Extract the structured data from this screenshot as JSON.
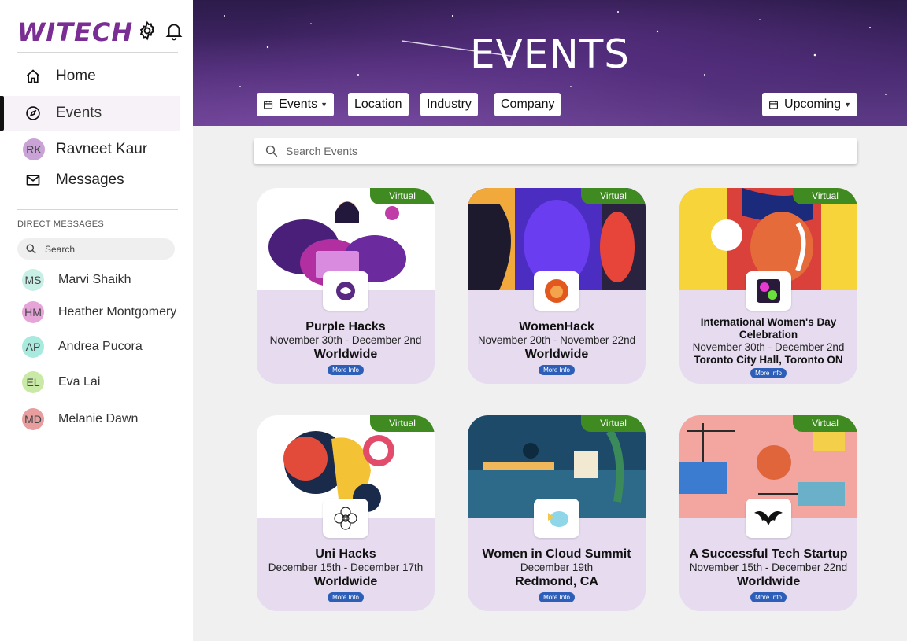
{
  "app": {
    "logo": "WITECH"
  },
  "nav": [
    {
      "label": "Home",
      "icon": "home-icon"
    },
    {
      "label": "Events",
      "icon": "compass-icon",
      "active": true
    },
    {
      "label": "Ravneet Kaur",
      "initials": "RK"
    },
    {
      "label": "Messages",
      "icon": "mail-icon"
    }
  ],
  "direct_messages": {
    "heading": "DIRECT MESSAGES",
    "search_placeholder": "Search",
    "contacts": [
      {
        "initials": "MS",
        "name": "Marvi Shaikh",
        "color": "#c8efe6"
      },
      {
        "initials": "HM",
        "name": "Heather Montgomery",
        "color": "#e6a5d8"
      },
      {
        "initials": "AP",
        "name": "Andrea Pucora",
        "color": "#a9eadf"
      },
      {
        "initials": "EL",
        "name": "Eva Lai",
        "color": "#c9e9a6"
      },
      {
        "initials": "MD",
        "name": "Melanie Dawn",
        "color": "#e89e9e"
      }
    ]
  },
  "header": {
    "title": "EVENTS",
    "filters": {
      "events": "Events",
      "location": "Location",
      "industry": "Industry",
      "company": "Company",
      "sort": "Upcoming"
    }
  },
  "search": {
    "placeholder": "Search Events"
  },
  "cards": [
    {
      "badge": "Virtual",
      "title": "Purple Hacks",
      "date": "November 30th - December 2nd",
      "location": "Worldwide",
      "button": "More Info"
    },
    {
      "badge": "Virtual",
      "title": "WomenHack",
      "date": "November 20th - November 22nd",
      "location": "Worldwide",
      "button": "More Info"
    },
    {
      "badge": "Virtual",
      "title_line1": "International Women's Day",
      "title_line2": "Celebration",
      "date": "November 30th - December 2nd",
      "location": "Toronto City Hall, Toronto ON",
      "button": "More Info"
    },
    {
      "badge": "Virtual",
      "title": "Uni Hacks",
      "date": "December 15th - December 17th",
      "location": "Worldwide",
      "button": "More Info"
    },
    {
      "badge": "Virtual",
      "title": "Women in Cloud Summit",
      "date": "December 19th",
      "location": "Redmond, CA",
      "button": "More Info"
    },
    {
      "badge": "Virtual",
      "title": "A Successful Tech Startup",
      "date": "November 15th - December 22nd",
      "location": "Worldwide",
      "button": "More Info"
    }
  ],
  "colors": {
    "brand": "#7a2d93",
    "badge": "#3f8b22",
    "card": "#e6dbef",
    "more_button": "#2d5fb8"
  }
}
